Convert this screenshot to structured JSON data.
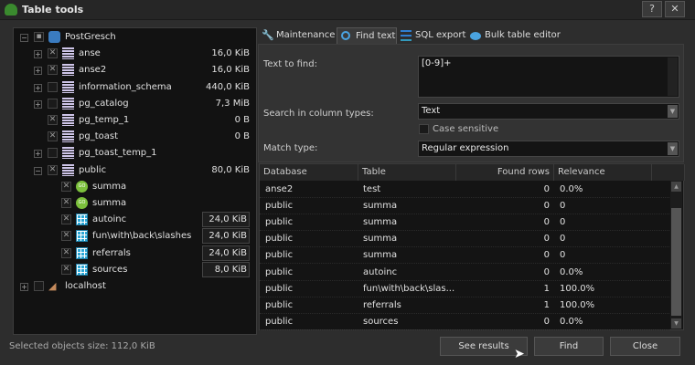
{
  "window": {
    "title": "Table tools",
    "help": "?",
    "close": "✕"
  },
  "tree": [
    {
      "level": 0,
      "exp": "−",
      "chk": "•",
      "icon": "db",
      "label": "PostGresch",
      "size": ""
    },
    {
      "level": 1,
      "exp": "+",
      "chk": "x",
      "icon": "schema",
      "label": "anse",
      "size": "16,0 KiB"
    },
    {
      "level": 1,
      "exp": "+",
      "chk": "x",
      "icon": "schema",
      "label": "anse2",
      "size": "16,0 KiB"
    },
    {
      "level": 1,
      "exp": "+",
      "chk": "",
      "icon": "schema",
      "label": "information_schema",
      "size": "440,0 KiB"
    },
    {
      "level": 1,
      "exp": "+",
      "chk": "",
      "icon": "schema",
      "label": "pg_catalog",
      "size": "7,3 MiB"
    },
    {
      "level": 1,
      "exp": "",
      "chk": "x",
      "icon": "schema",
      "label": "pg_temp_1",
      "size": "0 B"
    },
    {
      "level": 1,
      "exp": "",
      "chk": "x",
      "icon": "schema",
      "label": "pg_toast",
      "size": "0 B"
    },
    {
      "level": 1,
      "exp": "+",
      "chk": "",
      "icon": "schema",
      "label": "pg_toast_temp_1",
      "size": ""
    },
    {
      "level": 1,
      "exp": "−",
      "chk": "x",
      "icon": "schema",
      "label": "public",
      "size": "80,0 KiB"
    },
    {
      "level": 2,
      "exp": "",
      "chk": "x",
      "icon": "func",
      "label": "summa",
      "size": ""
    },
    {
      "level": 2,
      "exp": "",
      "chk": "x",
      "icon": "func",
      "label": "summa",
      "size": ""
    },
    {
      "level": 2,
      "exp": "",
      "chk": "x",
      "icon": "table",
      "label": "autoinc",
      "size": "24,0 KiB",
      "boxed": true
    },
    {
      "level": 2,
      "exp": "",
      "chk": "x",
      "icon": "table",
      "label": "fun\\with\\back\\slashes",
      "size": "24,0 KiB",
      "boxed": true
    },
    {
      "level": 2,
      "exp": "",
      "chk": "x",
      "icon": "table",
      "label": "referrals",
      "size": "24,0 KiB",
      "boxed": true
    },
    {
      "level": 2,
      "exp": "",
      "chk": "x",
      "icon": "table",
      "label": "sources",
      "size": "8,0 KiB",
      "boxed": true
    },
    {
      "level": 0,
      "exp": "+",
      "chk": "",
      "icon": "host",
      "label": "localhost",
      "size": ""
    }
  ],
  "status": "Selected objects size: 112,0 KiB",
  "tabs": [
    {
      "label": "Maintenance",
      "icon": "wrench-icon"
    },
    {
      "label": "Find text",
      "icon": "search-icon",
      "active": true
    },
    {
      "label": "SQL export",
      "icon": "export-icon"
    },
    {
      "label": "Bulk table editor",
      "icon": "table-editor-icon"
    }
  ],
  "form": {
    "text_to_find_label": "Text to find:",
    "text_to_find": "[0-9]+",
    "column_types_label": "Search in column types:",
    "column_types": "Text",
    "case_sensitive": "Case sensitive",
    "match_type_label": "Match type:",
    "match_type": "Regular expression"
  },
  "grid": {
    "headers": [
      "Database",
      "Table",
      "Found rows",
      "Relevance"
    ],
    "rows": [
      [
        "anse2",
        "test",
        "0",
        "0.0%"
      ],
      [
        "public",
        "summa",
        "0",
        "0"
      ],
      [
        "public",
        "summa",
        "0",
        "0"
      ],
      [
        "public",
        "summa",
        "0",
        "0"
      ],
      [
        "public",
        "summa",
        "0",
        "0"
      ],
      [
        "public",
        "autoinc",
        "0",
        "0.0%"
      ],
      [
        "public",
        "fun\\with\\back\\slas...",
        "1",
        "100.0%"
      ],
      [
        "public",
        "referrals",
        "1",
        "100.0%"
      ],
      [
        "public",
        "sources",
        "0",
        "0.0%"
      ]
    ]
  },
  "buttons": {
    "see_results": "See results",
    "find": "Find",
    "close": "Close"
  }
}
